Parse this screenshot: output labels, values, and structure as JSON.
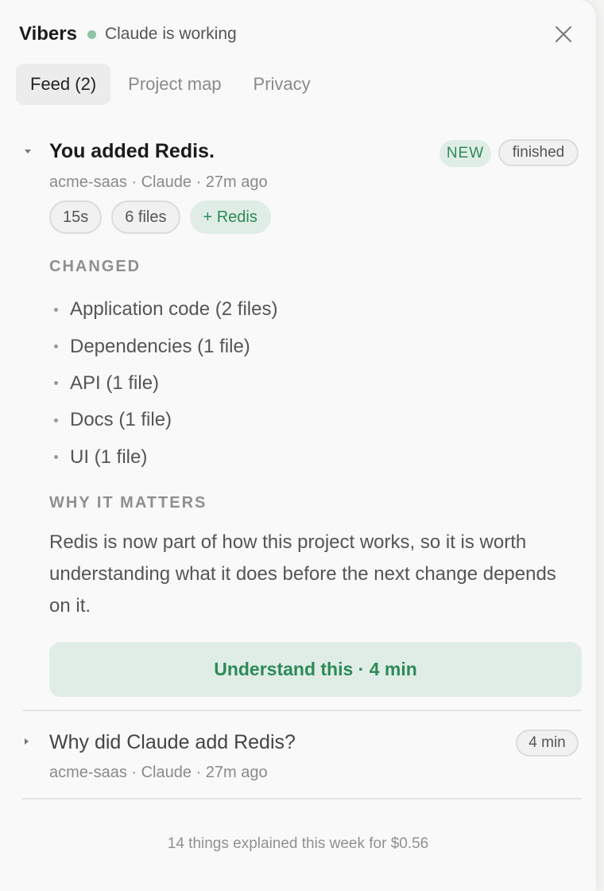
{
  "header": {
    "app_name": "Vibers",
    "status": "Claude is working"
  },
  "tabs": [
    {
      "label": "Feed (2)",
      "active": true
    },
    {
      "label": "Project map",
      "active": false
    },
    {
      "label": "Privacy",
      "active": false
    }
  ],
  "feed": [
    {
      "title": "You added Redis.",
      "expanded": true,
      "badges": [
        "NEW",
        "finished"
      ],
      "meta": "acme-saas · Claude · 27m ago",
      "chips": [
        "15s",
        "6 files",
        "+ Redis"
      ],
      "changed_label": "CHANGED",
      "changed_items": [
        "Application code (2 files)",
        "Dependencies (1 file)",
        "API (1 file)",
        "Docs (1 file)",
        "UI (1 file)"
      ],
      "why_label": "WHY IT MATTERS",
      "why_text": "Redis is now part of how this project works, so it is worth understanding what it does before the next change depends on it.",
      "cta_label": "Understand this · 4 min"
    },
    {
      "title": "Why did Claude add Redis?",
      "expanded": false,
      "badge": "4 min",
      "meta": "acme-saas · Claude · 27m ago"
    }
  ],
  "footer": "14 things explained this week for $0.56",
  "colors": {
    "accent_green": "#2d8a57",
    "accent_green_bg": "#e0ede6",
    "status_dot": "#8dc4a5"
  },
  "icons": {
    "close": "close-icon",
    "expanded": "caret-down-icon",
    "collapsed": "caret-right-icon"
  }
}
